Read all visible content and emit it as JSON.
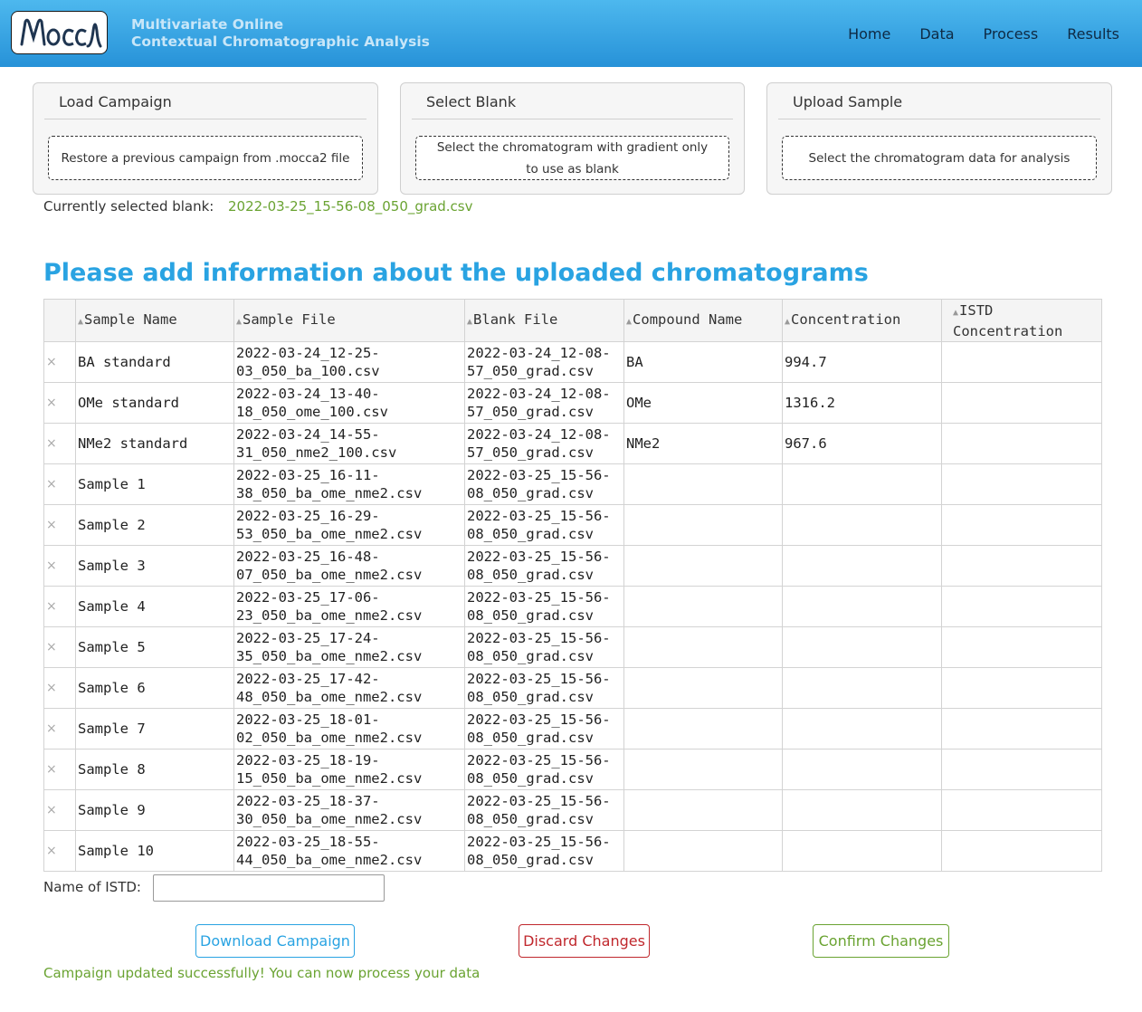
{
  "app": {
    "logo_text": "MOCCA",
    "title_line1": "Multivariate Online",
    "title_line2": "Contextual Chromatographic Analysis"
  },
  "nav": {
    "items": [
      "Home",
      "Data",
      "Process",
      "Results"
    ]
  },
  "panels": [
    {
      "title": "Load Campaign",
      "dropzone": "Restore a previous campaign from .mocca2 file"
    },
    {
      "title": "Select Blank",
      "dropzone": "Select the chromatogram with gradient only to use as blank"
    },
    {
      "title": "Upload Sample",
      "dropzone": "Select the chromatogram data for analysis"
    }
  ],
  "blank": {
    "label": "Currently selected blank:",
    "file": "2022-03-25_15-56-08_050_grad.csv"
  },
  "heading": "Please add information about the uploaded chromatograms",
  "table": {
    "delete_glyph": "×",
    "columns": [
      "Sample Name",
      "Sample File",
      "Blank File",
      "Compound Name",
      "Concentration",
      "ISTD Concentration"
    ],
    "rows": [
      {
        "sample_name": "BA standard",
        "sample_file": "2022-03-24_12-25-03_050_ba_100.csv",
        "blank_file": "2022-03-24_12-08-57_050_grad.csv",
        "compound": "BA",
        "concentration": "994.7",
        "istd_concentration": ""
      },
      {
        "sample_name": "OMe standard",
        "sample_file": "2022-03-24_13-40-18_050_ome_100.csv",
        "blank_file": "2022-03-24_12-08-57_050_grad.csv",
        "compound": "OMe",
        "concentration": "1316.2",
        "istd_concentration": ""
      },
      {
        "sample_name": "NMe2 standard",
        "sample_file": "2022-03-24_14-55-31_050_nme2_100.csv",
        "blank_file": "2022-03-24_12-08-57_050_grad.csv",
        "compound": "NMe2",
        "concentration": "967.6",
        "istd_concentration": ""
      },
      {
        "sample_name": "Sample 1",
        "sample_file": "2022-03-25_16-11-38_050_ba_ome_nme2.csv",
        "blank_file": "2022-03-25_15-56-08_050_grad.csv",
        "compound": "",
        "concentration": "",
        "istd_concentration": ""
      },
      {
        "sample_name": "Sample 2",
        "sample_file": "2022-03-25_16-29-53_050_ba_ome_nme2.csv",
        "blank_file": "2022-03-25_15-56-08_050_grad.csv",
        "compound": "",
        "concentration": "",
        "istd_concentration": ""
      },
      {
        "sample_name": "Sample 3",
        "sample_file": "2022-03-25_16-48-07_050_ba_ome_nme2.csv",
        "blank_file": "2022-03-25_15-56-08_050_grad.csv",
        "compound": "",
        "concentration": "",
        "istd_concentration": ""
      },
      {
        "sample_name": "Sample 4",
        "sample_file": "2022-03-25_17-06-23_050_ba_ome_nme2.csv",
        "blank_file": "2022-03-25_15-56-08_050_grad.csv",
        "compound": "",
        "concentration": "",
        "istd_concentration": ""
      },
      {
        "sample_name": "Sample 5",
        "sample_file": "2022-03-25_17-24-35_050_ba_ome_nme2.csv",
        "blank_file": "2022-03-25_15-56-08_050_grad.csv",
        "compound": "",
        "concentration": "",
        "istd_concentration": ""
      },
      {
        "sample_name": "Sample 6",
        "sample_file": "2022-03-25_17-42-48_050_ba_ome_nme2.csv",
        "blank_file": "2022-03-25_15-56-08_050_grad.csv",
        "compound": "",
        "concentration": "",
        "istd_concentration": ""
      },
      {
        "sample_name": "Sample 7",
        "sample_file": "2022-03-25_18-01-02_050_ba_ome_nme2.csv",
        "blank_file": "2022-03-25_15-56-08_050_grad.csv",
        "compound": "",
        "concentration": "",
        "istd_concentration": ""
      },
      {
        "sample_name": "Sample 8",
        "sample_file": "2022-03-25_18-19-15_050_ba_ome_nme2.csv",
        "blank_file": "2022-03-25_15-56-08_050_grad.csv",
        "compound": "",
        "concentration": "",
        "istd_concentration": ""
      },
      {
        "sample_name": "Sample 9",
        "sample_file": "2022-03-25_18-37-30_050_ba_ome_nme2.csv",
        "blank_file": "2022-03-25_15-56-08_050_grad.csv",
        "compound": "",
        "concentration": "",
        "istd_concentration": ""
      },
      {
        "sample_name": "Sample 10",
        "sample_file": "2022-03-25_18-55-44_050_ba_ome_nme2.csv",
        "blank_file": "2022-03-25_15-56-08_050_grad.csv",
        "compound": "",
        "concentration": "",
        "istd_concentration": ""
      }
    ]
  },
  "istd": {
    "label": "Name of ISTD:",
    "value": "",
    "placeholder": ""
  },
  "buttons": {
    "download": "Download Campaign",
    "discard": "Discard Changes",
    "confirm": "Confirm Changes"
  },
  "status": "Campaign updated successfully! You can now process your data",
  "colors": {
    "header": "#2ea3e5",
    "heading": "#29a3e2",
    "success": "#6aa332",
    "danger": "#c0282d"
  }
}
